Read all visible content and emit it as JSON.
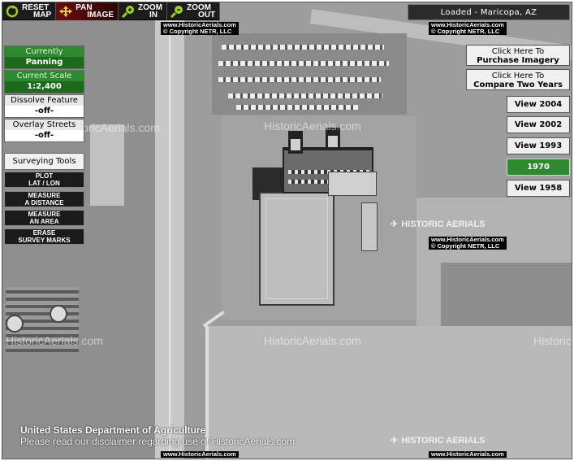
{
  "toolbar": {
    "reset": [
      "RESET",
      "MAP"
    ],
    "pan": [
      "PAN",
      "IMAGE"
    ],
    "zoom_in": [
      "ZOOM",
      "IN"
    ],
    "zoom_out": [
      "ZOOM",
      "OUT"
    ]
  },
  "status": "Loaded - Maricopa, AZ",
  "left_panel": {
    "currently": {
      "label": "Currently",
      "value": "Panning"
    },
    "scale": {
      "label": "Current Scale",
      "value": "1:2,400"
    },
    "dissolve": {
      "label": "Dissolve Feature",
      "value": "-off-"
    },
    "overlay": {
      "label": "Overlay Streets",
      "value": "-off-"
    },
    "surveying_label": "Surveying Tools",
    "tools": [
      {
        "line1": "PLOT",
        "line2": "LAT / LON"
      },
      {
        "line1": "MEASURE",
        "line2": "A DISTANCE"
      },
      {
        "line1": "MEASURE",
        "line2": "AN AREA"
      },
      {
        "line1": "ERASE",
        "line2": "SURVEY MARKS"
      }
    ]
  },
  "right_panel": {
    "purchase": {
      "line1": "Click Here To",
      "line2": "Purchase Imagery"
    },
    "compare": {
      "line1": "Click Here To",
      "line2": "Compare Two Years"
    },
    "years": [
      {
        "label": "View 2004",
        "active": false
      },
      {
        "label": "View 2002",
        "active": false
      },
      {
        "label": "View 1993",
        "active": false
      },
      {
        "label": "1970",
        "active": true
      },
      {
        "label": "View 1958",
        "active": false
      }
    ]
  },
  "watermarks": {
    "site": "HistoricAerials.com",
    "copyright_line1": "www.HistoricAerials.com",
    "copyright_line2": "© Copyright NETR, LLC",
    "stamp": "HISTORIC AERIALS"
  },
  "footer": {
    "line1": "United States Department of Agriculture",
    "line2": "Please read our disclaimer regarding use of HistoricAerials.com"
  },
  "colors": {
    "active_green": "#2f8a2f",
    "toolbar": "#1c1c1c"
  }
}
